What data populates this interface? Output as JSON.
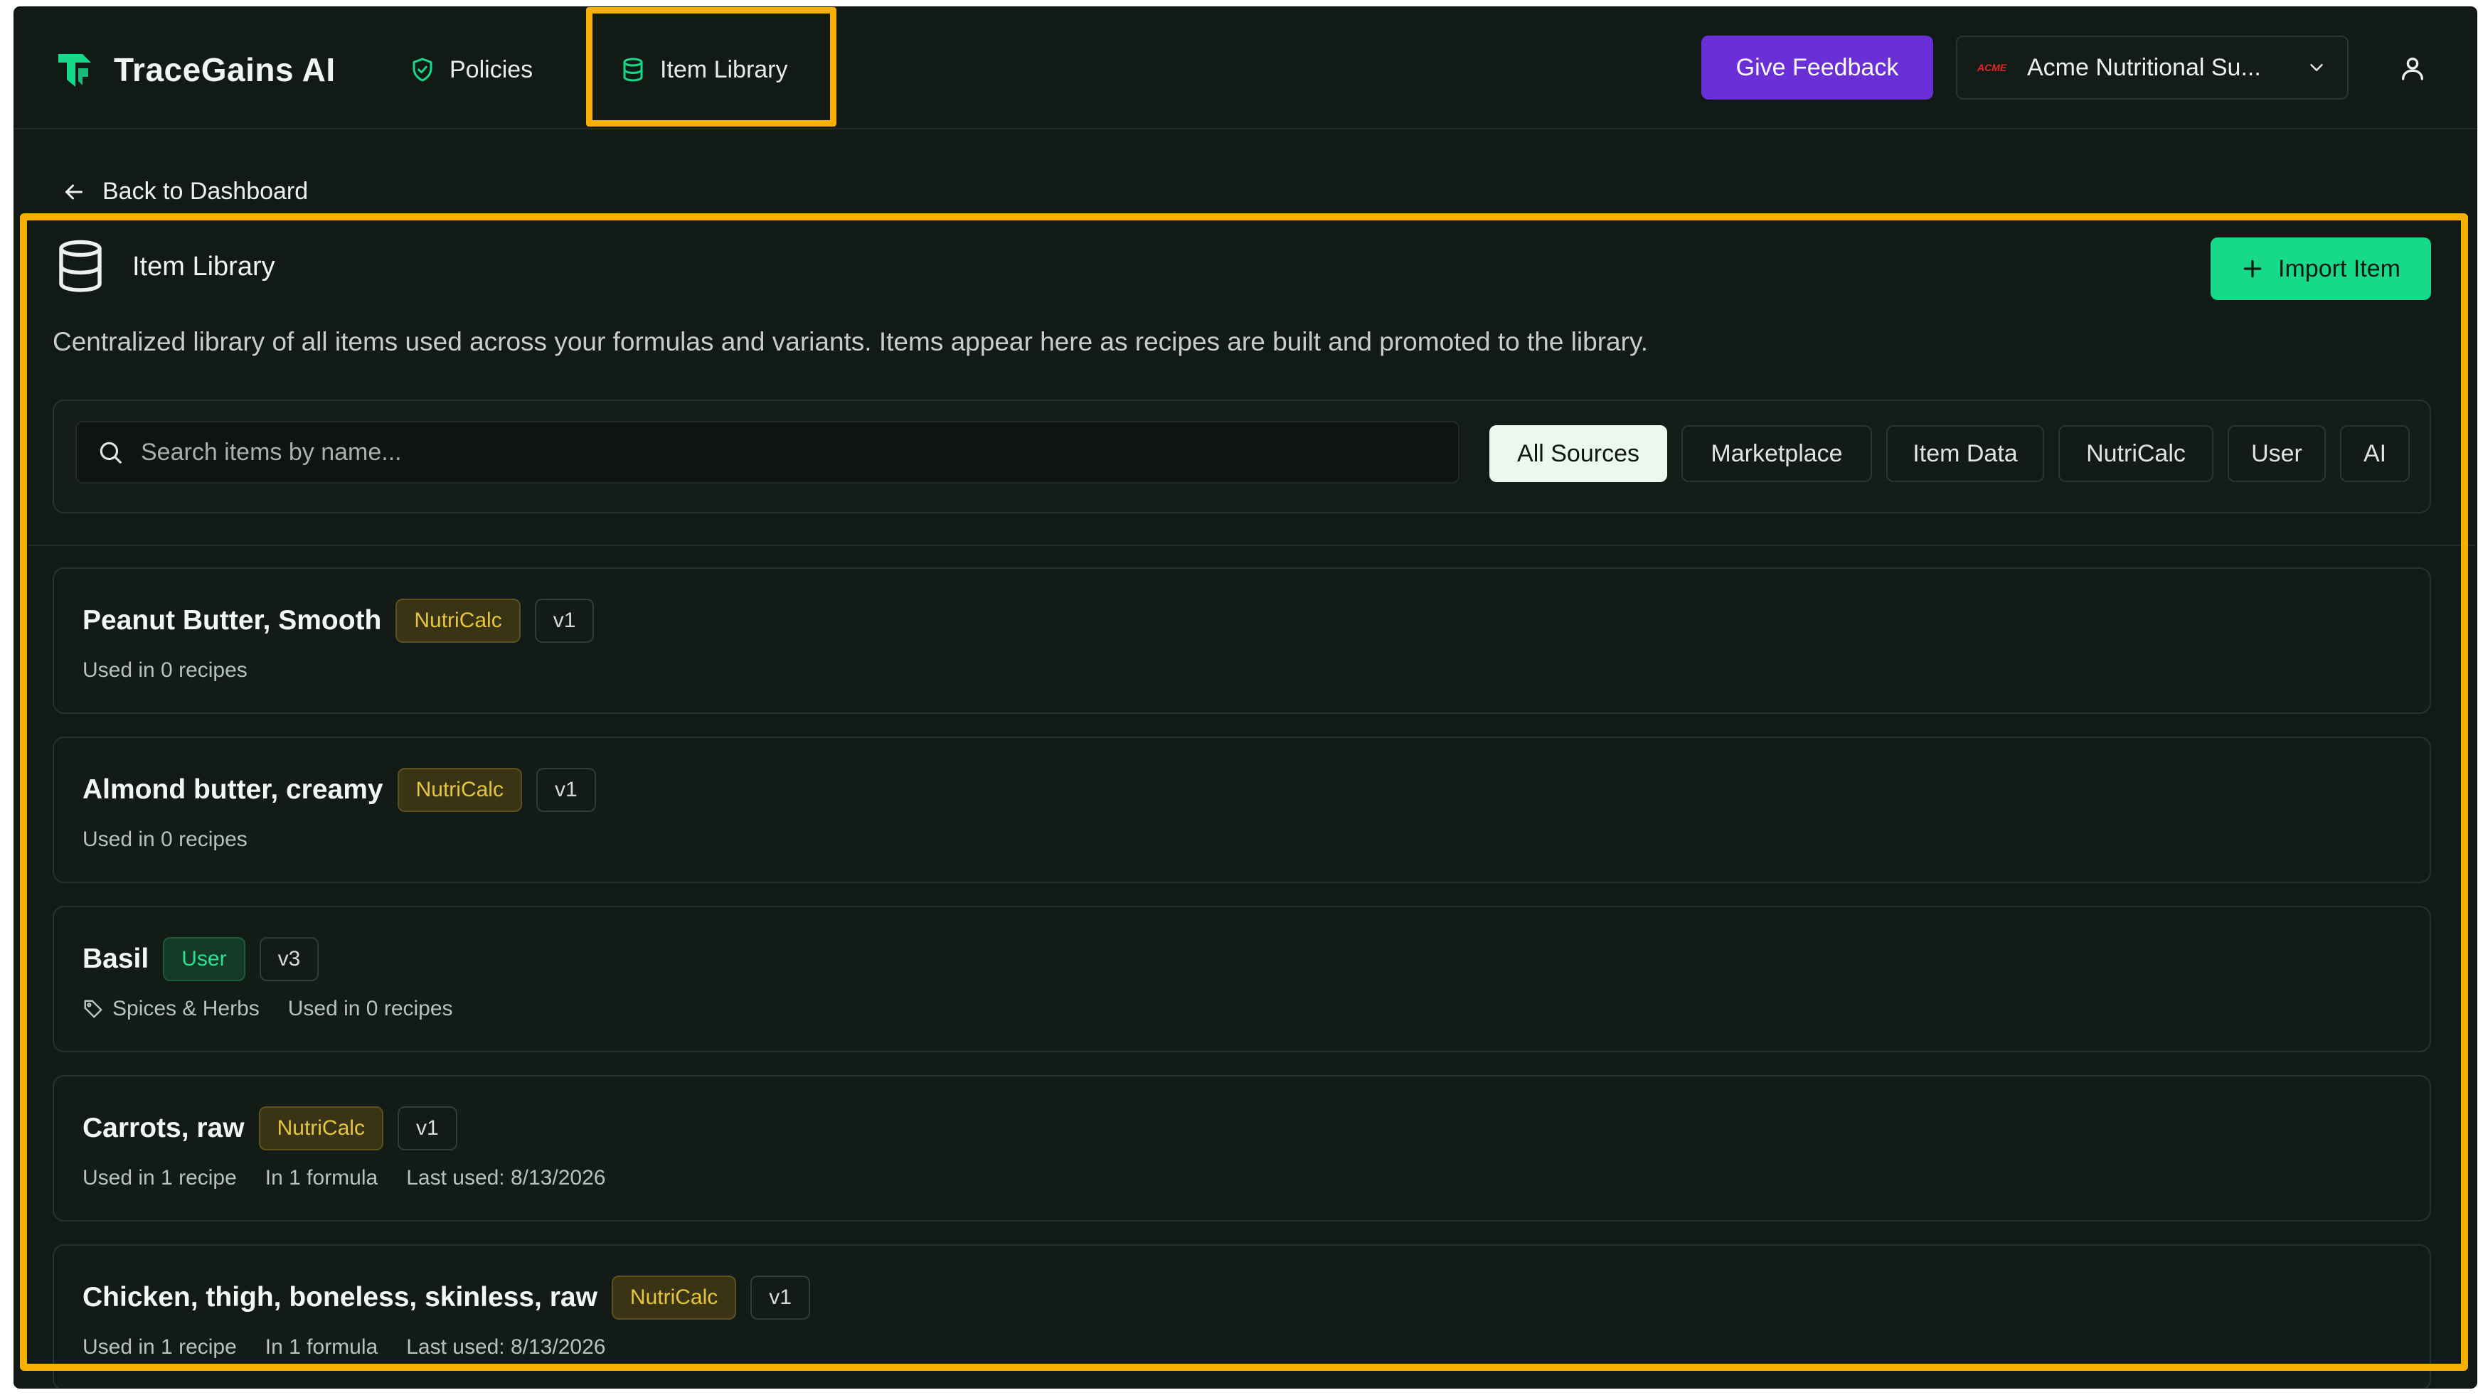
{
  "app": {
    "brand": "TraceGains AI"
  },
  "nav": {
    "policies": "Policies",
    "item_library": "Item Library",
    "give_feedback": "Give Feedback",
    "org_logo": "ACME",
    "org_name": "Acme Nutritional Su..."
  },
  "back_link": "Back to Dashboard",
  "panel": {
    "title": "Item Library",
    "import_label": "Import Item",
    "description": "Centralized library of all items used across your formulas and variants. Items appear here as recipes are built and promoted to the library."
  },
  "filters": {
    "search_placeholder": "Search items by name...",
    "chips": [
      "All Sources",
      "Marketplace",
      "Item Data",
      "NutriCalc",
      "User",
      "AI"
    ],
    "active": "All Sources"
  },
  "items": [
    {
      "name": "Peanut Butter, Smooth",
      "source": "NutriCalc",
      "version": "v1",
      "category": "",
      "usage": "Used in 0 recipes",
      "formula": "",
      "last_used": ""
    },
    {
      "name": "Almond butter, creamy",
      "source": "NutriCalc",
      "version": "v1",
      "category": "",
      "usage": "Used in 0 recipes",
      "formula": "",
      "last_used": ""
    },
    {
      "name": "Basil",
      "source": "User",
      "version": "v3",
      "category": "Spices & Herbs",
      "usage": "Used in 0 recipes",
      "formula": "",
      "last_used": ""
    },
    {
      "name": "Carrots, raw",
      "source": "NutriCalc",
      "version": "v1",
      "category": "",
      "usage": "Used in 1 recipe",
      "formula": "In 1 formula",
      "last_used": "Last used: 8/13/2026"
    },
    {
      "name": "Chicken, thigh, boneless, skinless, raw",
      "source": "NutriCalc",
      "version": "v1",
      "category": "",
      "usage": "Used in 1 recipe",
      "formula": "In 1 formula",
      "last_used": "Last used: 8/13/2026"
    }
  ],
  "colors": {
    "background": "#121a15",
    "accent_green": "#16d98a",
    "feedback_purple": "#6b2fd8",
    "highlight": "#f5b000",
    "nutricalc_badge": "#e5c640",
    "user_badge": "#2fe08f"
  }
}
